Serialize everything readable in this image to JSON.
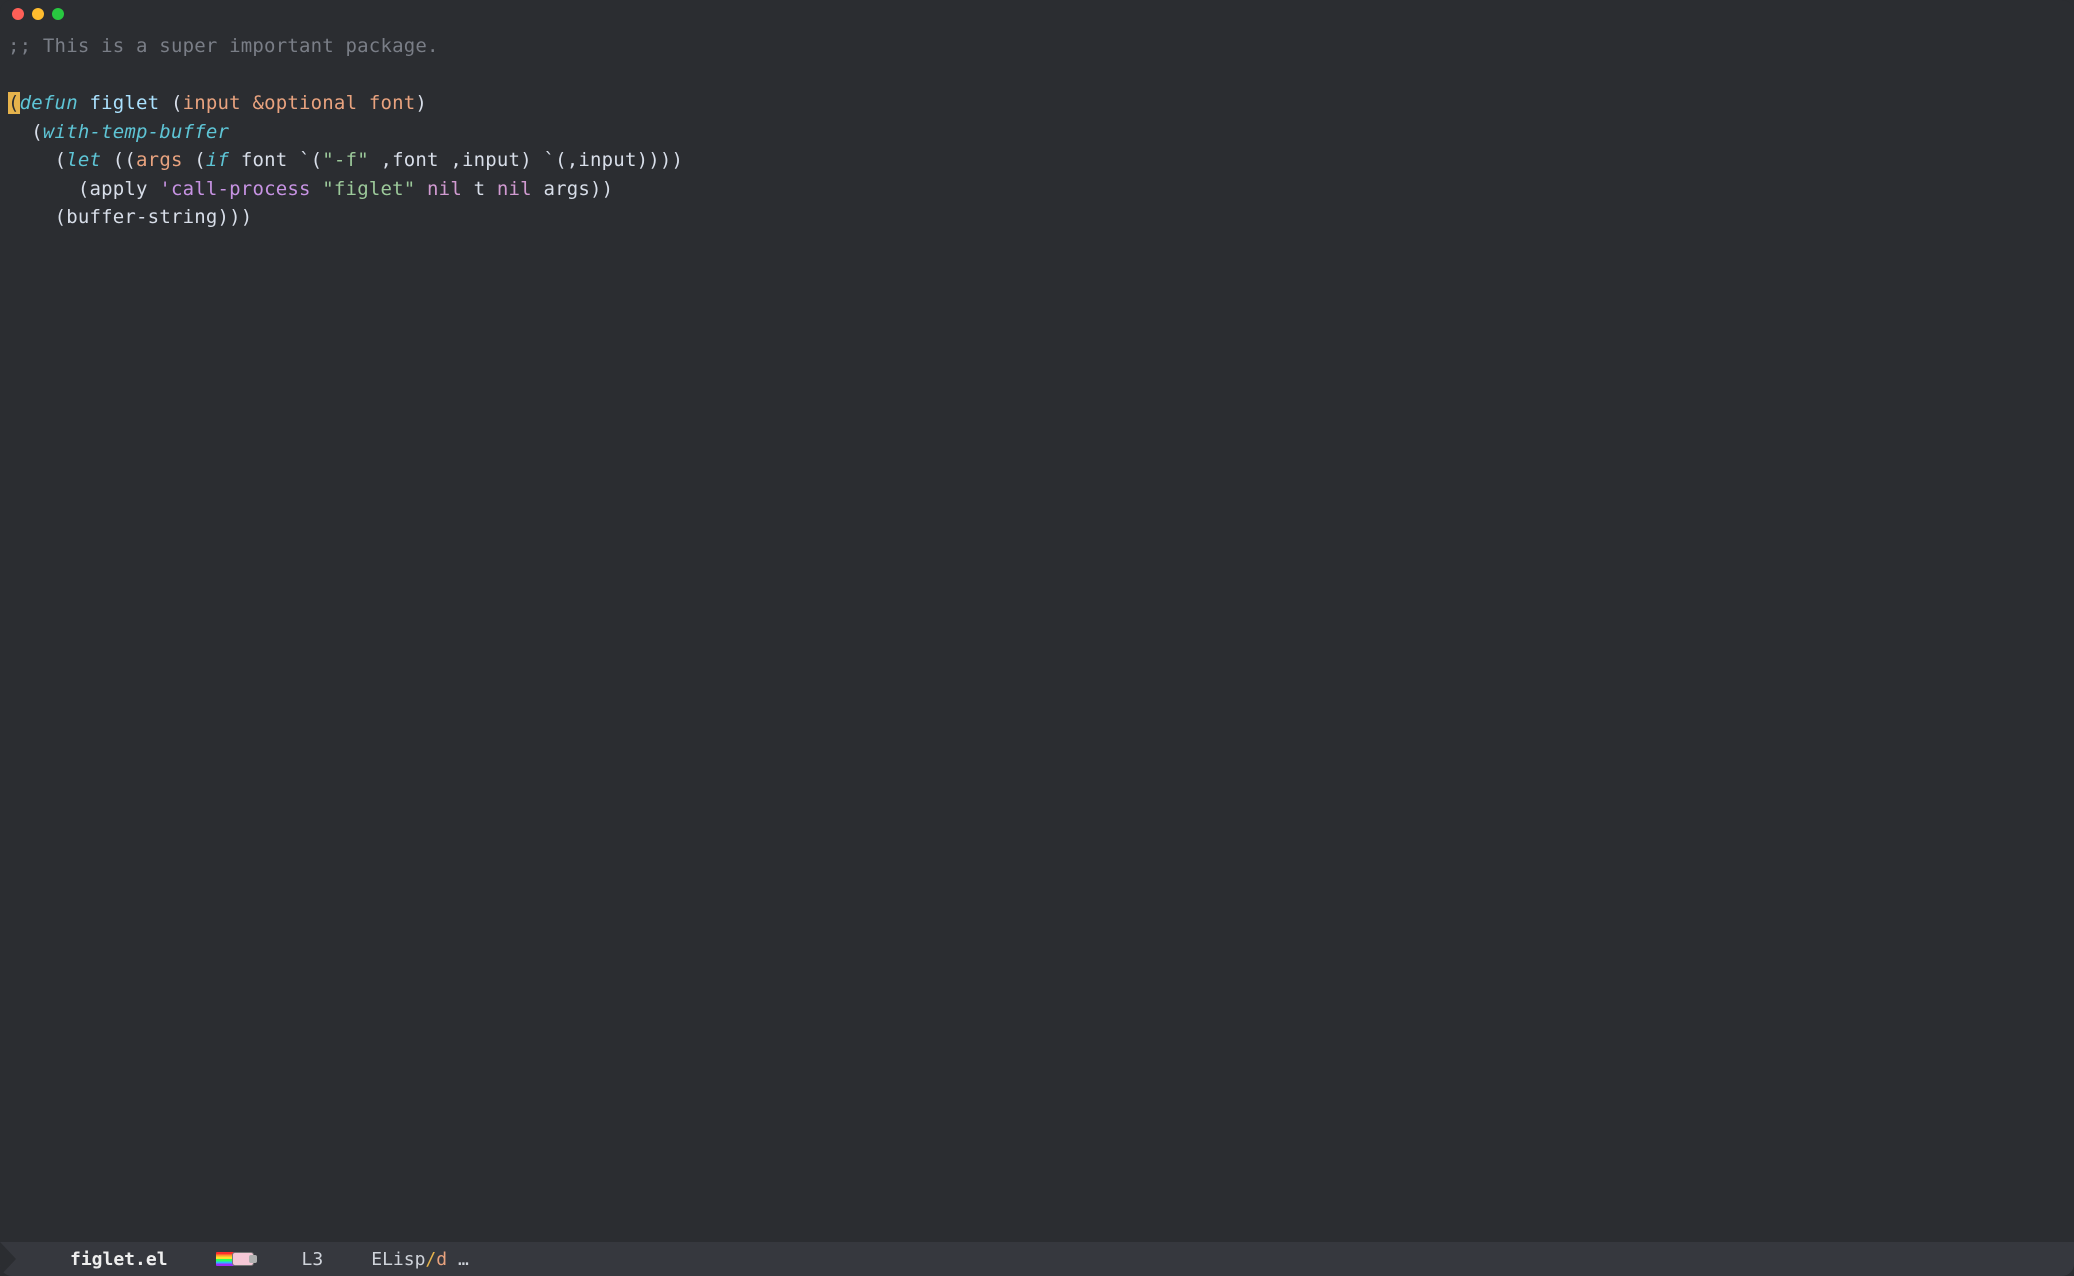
{
  "titlebar": {
    "buttons": [
      "close",
      "minimize",
      "zoom"
    ]
  },
  "code": {
    "comment": ";; This is a super important package.",
    "defun": "defun",
    "funcname": "figlet",
    "param_input": "input",
    "optional": "&optional",
    "param_font": "font",
    "with_temp_buffer": "with-temp-buffer",
    "let": "let",
    "args": "args",
    "if": "if",
    "font_var": "font",
    "flag_f": "\"-f\"",
    "font_ref": ",font",
    "input_ref": ",input",
    "input_ref2": ",input",
    "apply": "apply",
    "call_process": "'call-process",
    "figlet_str": "\"figlet\"",
    "nil1": "nil",
    "t": "t",
    "nil2": "nil",
    "args_ref": "args",
    "buffer_string": "buffer-string"
  },
  "modeline": {
    "filename": "figlet.el",
    "line": "L3",
    "mode": "ELisp",
    "sep": "/",
    "submode": "d",
    "trail": " …"
  }
}
